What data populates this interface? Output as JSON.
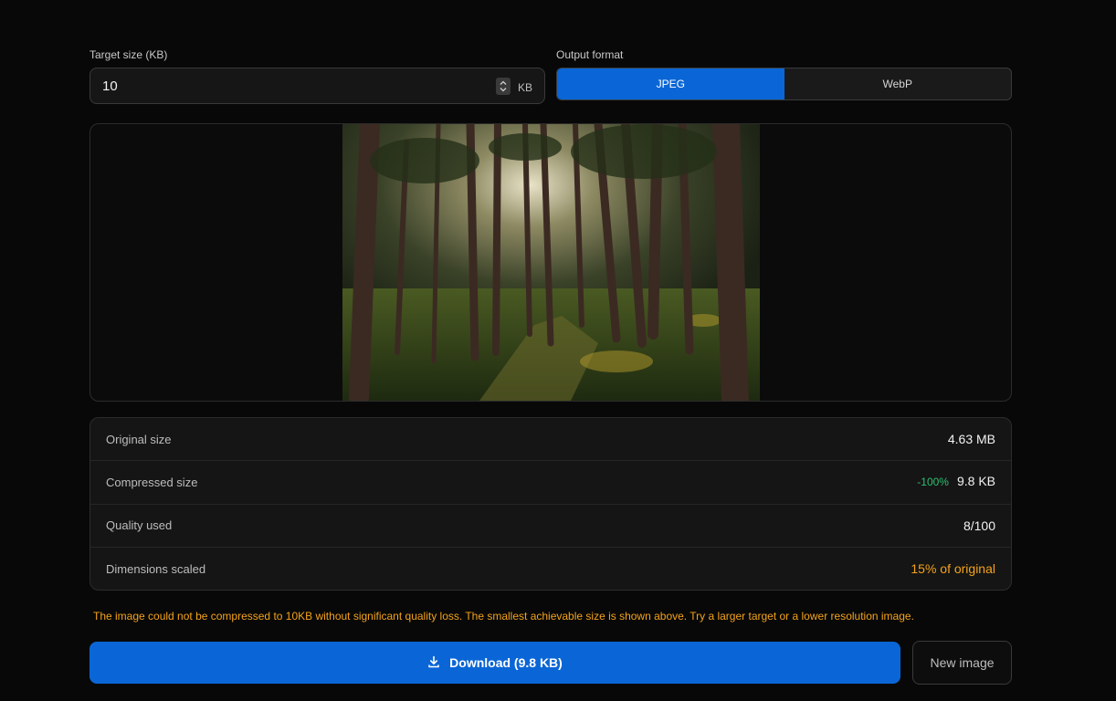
{
  "target": {
    "label": "Target size (KB)",
    "value": "10",
    "unit": "KB"
  },
  "format": {
    "label": "Output format",
    "options": [
      "JPEG",
      "WebP"
    ],
    "selected": "JPEG"
  },
  "stats": {
    "original_label": "Original size",
    "original_value": "4.63 MB",
    "compressed_label": "Compressed size",
    "compressed_change": "-100%",
    "compressed_value": "9.8 KB",
    "quality_label": "Quality used",
    "quality_value": "8/100",
    "dimensions_label": "Dimensions scaled",
    "dimensions_value": "15% of original"
  },
  "notice": "The image could not be compressed to 10KB without significant quality loss. The smallest achievable size is shown above. Try a larger target or a lower resolution image.",
  "actions": {
    "download": "Download (9.8 KB)",
    "new_image": "New image"
  },
  "colors": {
    "accent": "#0a66d6",
    "success": "#2fbf71",
    "warning": "#f3a21b"
  },
  "icons": {
    "download": "download-icon",
    "spinner": "chevron-up-down-icon"
  }
}
